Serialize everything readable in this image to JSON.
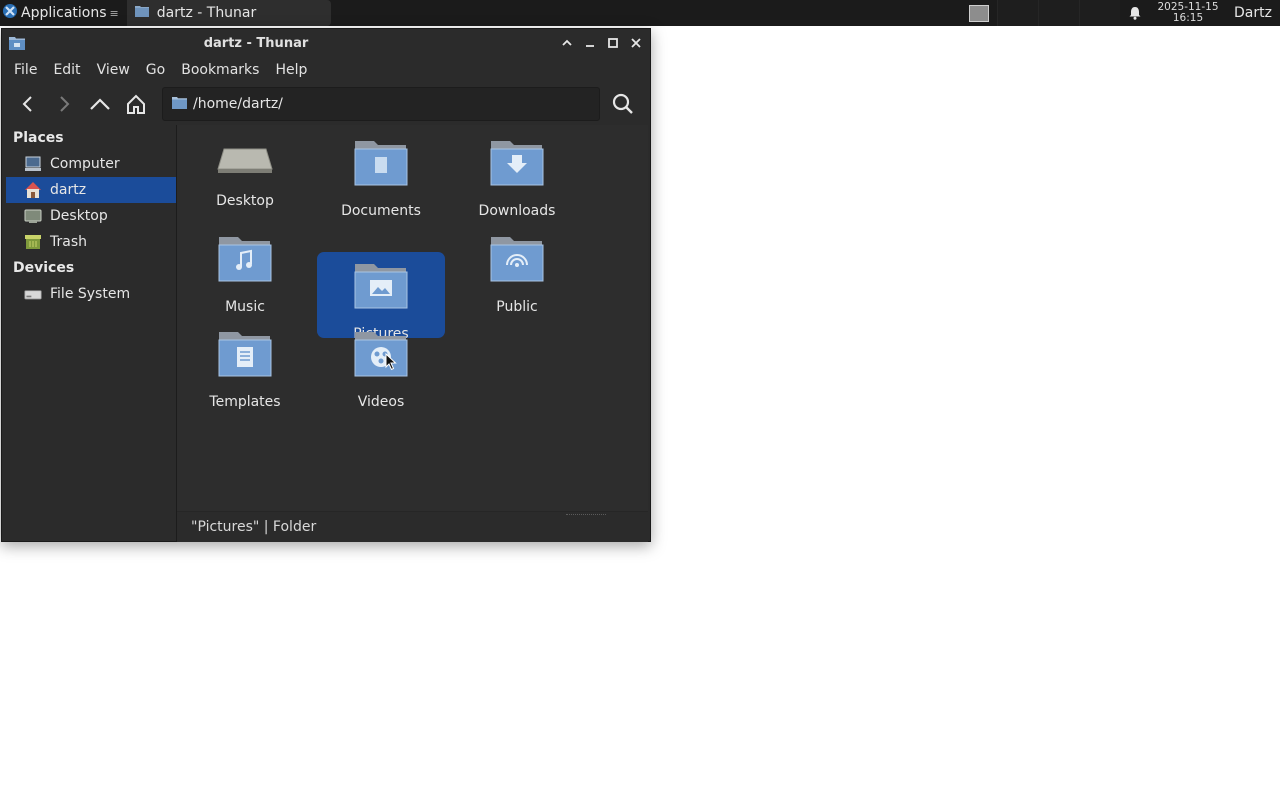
{
  "panel": {
    "applications_label": "Applications",
    "task_label": "dartz - Thunar",
    "clock_date": "2025-11-15",
    "clock_time": "16:15",
    "user": "Dartz"
  },
  "window": {
    "title": "dartz - Thunar"
  },
  "menubar": {
    "file": "File",
    "edit": "Edit",
    "view": "View",
    "go": "Go",
    "bookmarks": "Bookmarks",
    "help": "Help"
  },
  "location": {
    "path": "/home/dartz/"
  },
  "sidebar": {
    "places_heading": "Places",
    "places": [
      {
        "label": "Computer",
        "icon": "computer-icon"
      },
      {
        "label": "dartz",
        "icon": "home-icon",
        "active": true
      },
      {
        "label": "Desktop",
        "icon": "desktop-icon"
      },
      {
        "label": "Trash",
        "icon": "trash-icon"
      }
    ],
    "devices_heading": "Devices",
    "devices": [
      {
        "label": "File System",
        "icon": "drive-icon"
      }
    ]
  },
  "files": [
    {
      "label": "Desktop",
      "icon": "desktop-folder-icon"
    },
    {
      "label": "Documents",
      "icon": "documents-folder-icon"
    },
    {
      "label": "Downloads",
      "icon": "downloads-folder-icon"
    },
    {
      "label": "Music",
      "icon": "music-folder-icon"
    },
    {
      "label": "Pictures",
      "icon": "pictures-folder-icon",
      "selected": true
    },
    {
      "label": "Public",
      "icon": "public-folder-icon"
    },
    {
      "label": "Templates",
      "icon": "templates-folder-icon"
    },
    {
      "label": "Videos",
      "icon": "videos-folder-icon"
    }
  ],
  "status": {
    "text": "\"Pictures\"  |  Folder"
  },
  "colors": {
    "selection": "#1b4c9a",
    "panel_bg": "#1b1b1b",
    "window_bg": "#2b2b2b"
  }
}
